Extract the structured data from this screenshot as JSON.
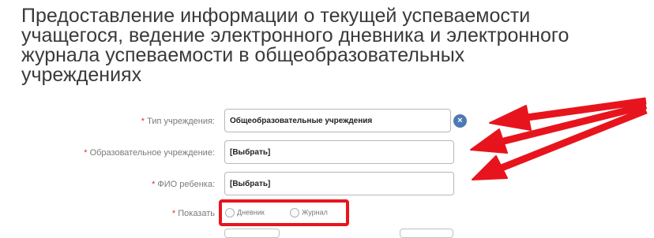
{
  "page": {
    "title": "Предоставление информации о текущей успеваемости учащегося, ведение электронного дневника и электронного журнала успеваемости в общеобразовательных учреждениях"
  },
  "form": {
    "institution_type": {
      "required_mark": "*",
      "label": "Тип учреждения:",
      "value": "Общеобразовательные учреждения"
    },
    "institution": {
      "required_mark": "*",
      "label": "Образовательное учреждение:",
      "value": "[Выбрать]"
    },
    "child_name": {
      "required_mark": "*",
      "label": "ФИО ребенка:",
      "value": "[Выбрать]"
    },
    "show": {
      "required_mark": "*",
      "label": "Показать",
      "options": [
        "Дневник",
        "Журнал"
      ]
    }
  },
  "icons": {
    "clear": "clear-x-icon"
  },
  "colors": {
    "annotation_red": "#e8141d",
    "clear_icon_blue": "#4f79b4",
    "required_star": "#e03030"
  }
}
